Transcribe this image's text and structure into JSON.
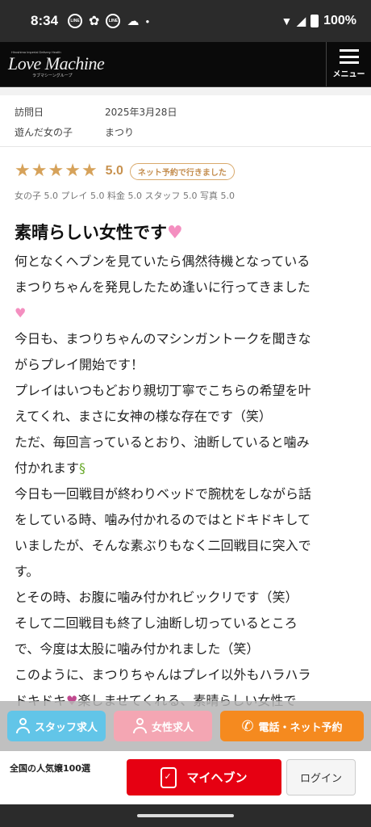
{
  "status_bar": {
    "time": "8:34",
    "icons": [
      "line-icon",
      "pinwheel-icon",
      "line-icon",
      "cloud-icon",
      "dot-icon"
    ],
    "battery": "100%"
  },
  "header": {
    "logo_small": "Hiroshima Imperial Delivery Health",
    "logo_main": "Love Machine",
    "logo_sub": "ラブマシーングループ",
    "menu_label": "メニュー"
  },
  "info": {
    "visit_label": "訪問日",
    "visit_value": "2025年3月28日",
    "girl_label": "遊んだ女の子",
    "girl_value": "まつり"
  },
  "rating": {
    "stars": 5,
    "score": "5.0",
    "badge": "ネット予約で行きました",
    "subscores": "女の子 5.0 プレイ 5.0 料金 5.0 スタッフ 5.0 写真 5.0",
    "star_color": "#d6a25a"
  },
  "review": {
    "title": "素晴らしい女性です",
    "lines": [
      "何となくヘブンを見ていたら偶然待機となっている",
      "まつりちゃんを発見したため逢いに行ってきました",
      "",
      "今日も、まつりちゃんのマシンガントークを聞きな",
      "がらプレイ開始です！",
      "プレイはいつもどおり親切丁寧でこちらの希望を叶",
      "えてくれ、まさに女神の様な存在です（笑）",
      "ただ、毎回言っているとおり、油断していると噛み",
      "付かれます",
      "今日も一回戦目が終わりベッドで腕枕をしながら話",
      "をしている時、噛み付かれるのではとドキドキして",
      "いましたが、そんな素ぶりもなく二回戦目に突入で",
      "す。",
      "とその時、お腹に噛み付かれビックリです（笑）",
      "そして二回戦目も終了し油断し切っているところ",
      "で、今度は太股に噛み付かれました（笑）",
      "このように、まつりちゃんはプレイ以外もハラハラ",
      "ドキドキ",
      "楽しませてくれる、素晴らしい女性で"
    ]
  },
  "action_buttons": {
    "staff": "スタッフ求人",
    "female": "女性求人",
    "phone": "電話・ネット予約",
    "staff_color": "#62c5e8",
    "female_color": "#f4a6b3",
    "phone_color": "#f58a1f"
  },
  "bottom_bar": {
    "label": "全国の人気嬢100選",
    "myheaven": "マイヘブン",
    "login": "ログイン",
    "myheaven_color": "#e60012"
  }
}
